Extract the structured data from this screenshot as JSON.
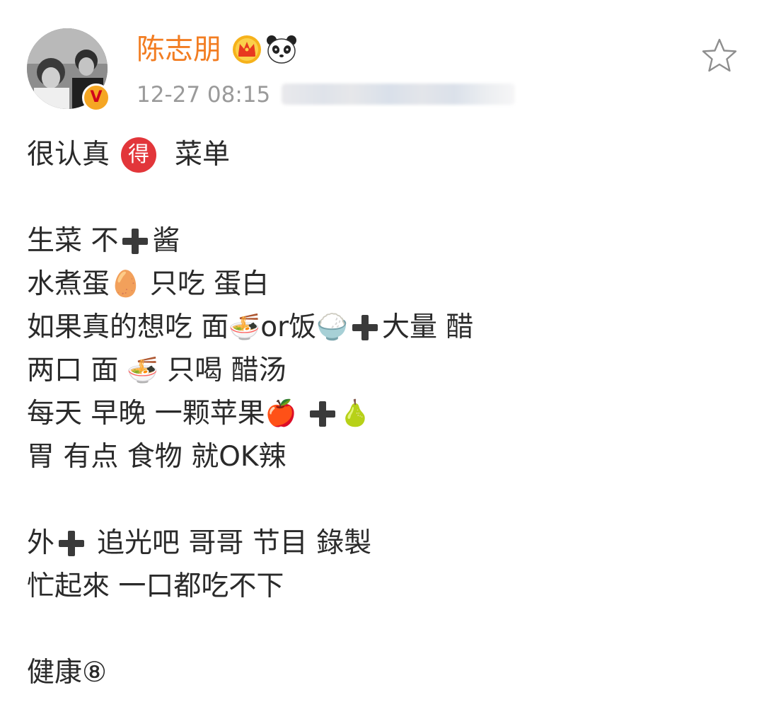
{
  "post": {
    "author": "陈志朋",
    "author_badge": "V",
    "timestamp": "12-27 08:15",
    "badge_icons": [
      "crown-icon",
      "panda-icon"
    ],
    "favorite_icon": "star-outline-icon"
  },
  "content": {
    "line1_a": "很认真",
    "line1_badge": "得",
    "line1_b": "菜单",
    "line2_a": "生菜 不",
    "line2_b": "酱",
    "line3_a": "水煮蛋",
    "line3_emoji": "🥚",
    "line3_b": "只吃 蛋白",
    "line4_a": "如果真的想吃 面",
    "line4_emoji1": "🍜",
    "line4_b": "or饭",
    "line4_emoji2": "🍚",
    "line4_c": "大量 醋",
    "line5_a": "两口 面",
    "line5_emoji": "🍜",
    "line5_b": "只喝 醋汤",
    "line6_a": "每天 早晚 一颗苹果",
    "line6_emoji1": "🍎",
    "line6_emoji2": "🍐",
    "line7": "胃 有点 食物 就OK辣",
    "line8_a": "外",
    "line8_b": "追光吧 哥哥 节目 錄製",
    "line9": "忙起來 一口都吃不下",
    "line10": "健康⑧"
  },
  "colors": {
    "author": "#f27d22",
    "timestamp": "#9a9a9a",
    "text": "#2a2a2a",
    "badge_red": "#e2363a",
    "verified_bg": "#f5a623"
  }
}
